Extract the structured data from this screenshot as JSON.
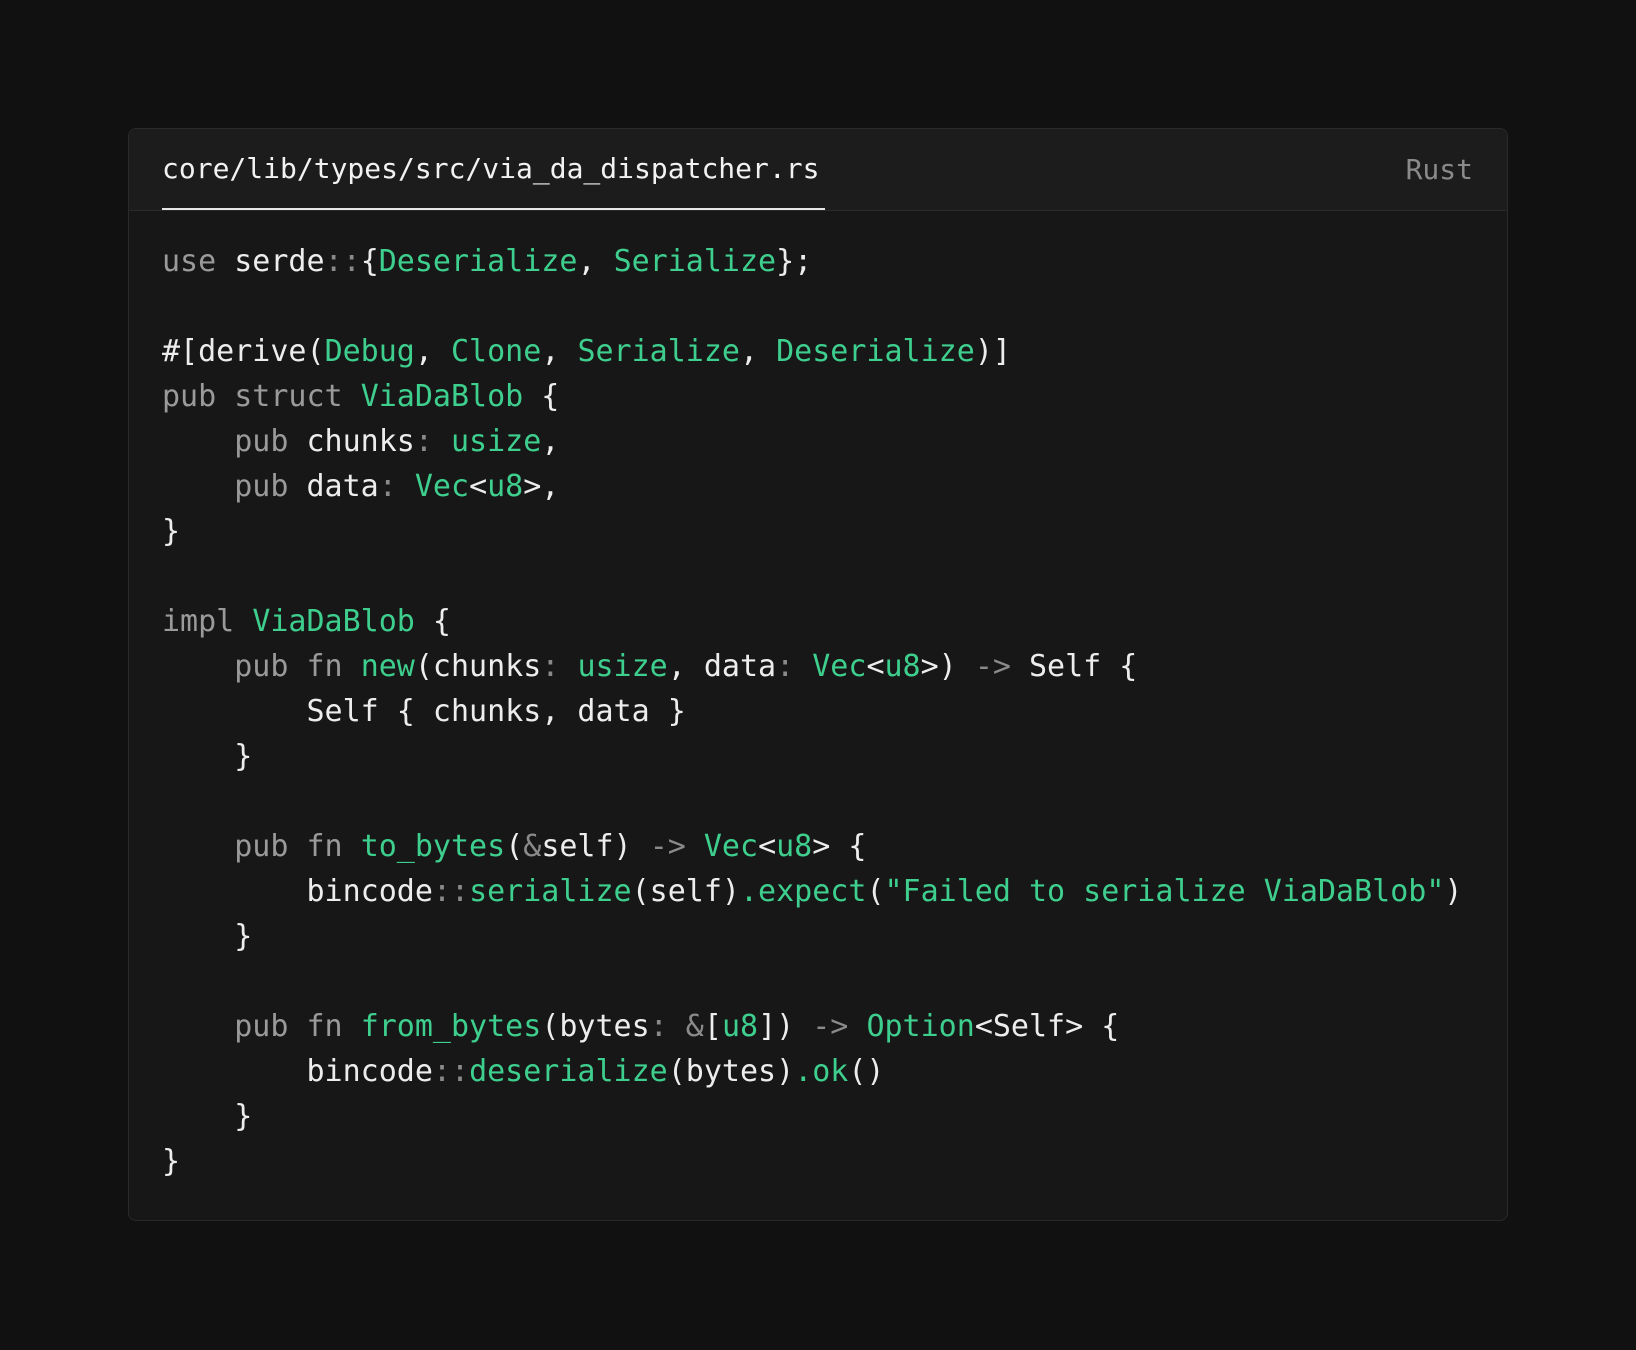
{
  "editor": {
    "filename": "core/lib/types/src/via_da_dispatcher.rs",
    "language": "Rust"
  },
  "code": {
    "lines": [
      [
        [
          "kw",
          "use"
        ],
        [
          "id",
          " serde"
        ],
        [
          "pu",
          "::"
        ],
        [
          "id",
          "{"
        ],
        [
          "ty",
          "Deserialize"
        ],
        [
          "id",
          ", "
        ],
        [
          "ty",
          "Serialize"
        ],
        [
          "id",
          "};"
        ]
      ],
      [],
      [
        [
          "id",
          "#[derive("
        ],
        [
          "ty",
          "Debug"
        ],
        [
          "id",
          ", "
        ],
        [
          "ty",
          "Clone"
        ],
        [
          "id",
          ", "
        ],
        [
          "ty",
          "Serialize"
        ],
        [
          "id",
          ", "
        ],
        [
          "ty",
          "Deserialize"
        ],
        [
          "id",
          ")]"
        ]
      ],
      [
        [
          "kw",
          "pub struct "
        ],
        [
          "ty",
          "ViaDaBlob"
        ],
        [
          "id",
          " {"
        ]
      ],
      [
        [
          "id",
          "    "
        ],
        [
          "kw",
          "pub"
        ],
        [
          "id",
          " chunks"
        ],
        [
          "pu",
          ": "
        ],
        [
          "ty",
          "usize"
        ],
        [
          "id",
          ","
        ]
      ],
      [
        [
          "id",
          "    "
        ],
        [
          "kw",
          "pub"
        ],
        [
          "id",
          " data"
        ],
        [
          "pu",
          ": "
        ],
        [
          "ty",
          "Vec"
        ],
        [
          "id",
          "<"
        ],
        [
          "ty",
          "u8"
        ],
        [
          "id",
          ">,"
        ]
      ],
      [
        [
          "id",
          "}"
        ]
      ],
      [],
      [
        [
          "kw",
          "impl "
        ],
        [
          "ty",
          "ViaDaBlob"
        ],
        [
          "id",
          " {"
        ]
      ],
      [
        [
          "id",
          "    "
        ],
        [
          "kw",
          "pub fn "
        ],
        [
          "fn",
          "new"
        ],
        [
          "id",
          "(chunks"
        ],
        [
          "pu",
          ": "
        ],
        [
          "ty",
          "usize"
        ],
        [
          "id",
          ", data"
        ],
        [
          "pu",
          ": "
        ],
        [
          "ty",
          "Vec"
        ],
        [
          "id",
          "<"
        ],
        [
          "ty",
          "u8"
        ],
        [
          "id",
          ">) "
        ],
        [
          "pu",
          "->"
        ],
        [
          "id",
          " Self {"
        ]
      ],
      [
        [
          "id",
          "        Self { chunks, data }"
        ]
      ],
      [
        [
          "id",
          "    }"
        ]
      ],
      [],
      [
        [
          "id",
          "    "
        ],
        [
          "kw",
          "pub fn "
        ],
        [
          "fn",
          "to_bytes"
        ],
        [
          "id",
          "("
        ],
        [
          "pu",
          "&"
        ],
        [
          "id",
          "self) "
        ],
        [
          "pu",
          "->"
        ],
        [
          "id",
          " "
        ],
        [
          "ty",
          "Vec"
        ],
        [
          "id",
          "<"
        ],
        [
          "ty",
          "u8"
        ],
        [
          "id",
          "> {"
        ]
      ],
      [
        [
          "id",
          "        bincode"
        ],
        [
          "pu",
          "::"
        ],
        [
          "fn",
          "serialize"
        ],
        [
          "id",
          "(self)"
        ],
        [
          "fn",
          ".expect"
        ],
        [
          "id",
          "("
        ],
        [
          "st",
          "\"Failed to serialize ViaDaBlob\""
        ],
        [
          "id",
          ")"
        ]
      ],
      [
        [
          "id",
          "    }"
        ]
      ],
      [],
      [
        [
          "id",
          "    "
        ],
        [
          "kw",
          "pub fn "
        ],
        [
          "fn",
          "from_bytes"
        ],
        [
          "id",
          "(bytes"
        ],
        [
          "pu",
          ": &"
        ],
        [
          "id",
          "["
        ],
        [
          "ty",
          "u8"
        ],
        [
          "id",
          "]) "
        ],
        [
          "pu",
          "->"
        ],
        [
          "id",
          " "
        ],
        [
          "ty",
          "Option"
        ],
        [
          "id",
          "<Self> {"
        ]
      ],
      [
        [
          "id",
          "        bincode"
        ],
        [
          "pu",
          "::"
        ],
        [
          "fn",
          "deserialize"
        ],
        [
          "id",
          "(bytes)"
        ],
        [
          "fn",
          ".ok"
        ],
        [
          "id",
          "()"
        ]
      ],
      [
        [
          "id",
          "    }"
        ]
      ],
      [
        [
          "id",
          "}"
        ]
      ]
    ]
  }
}
